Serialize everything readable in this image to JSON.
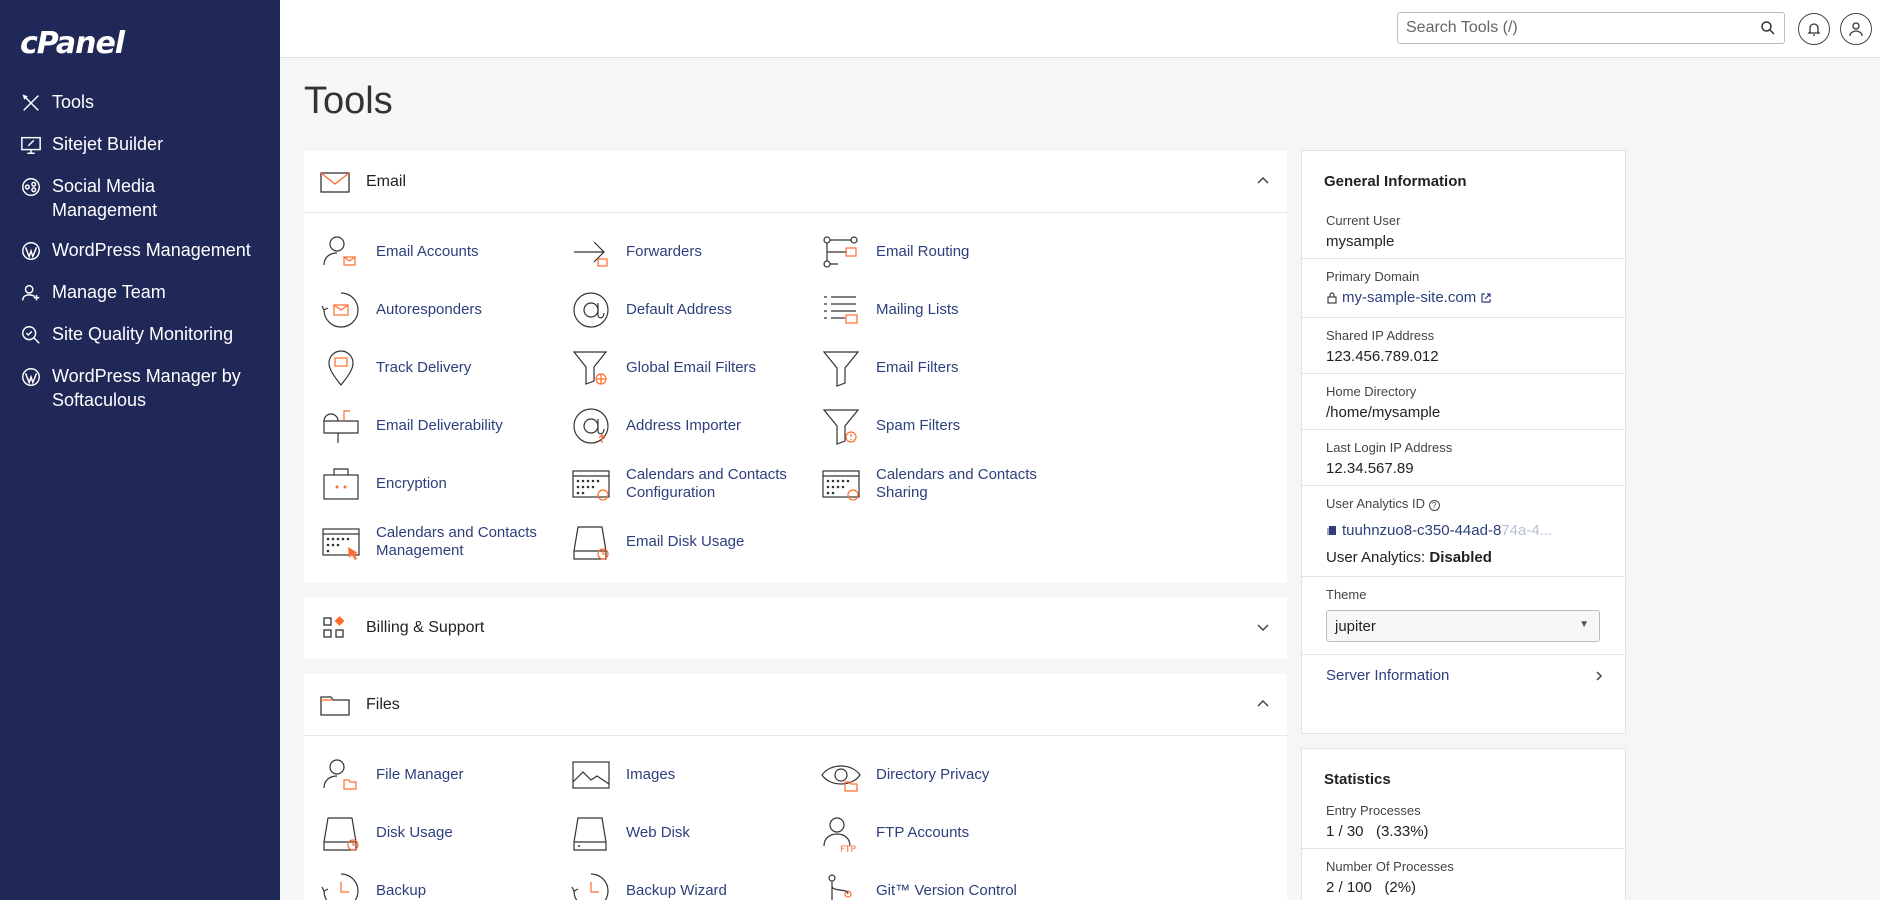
{
  "brand": "cPanel",
  "sidebar": {
    "items": [
      {
        "label": "Tools"
      },
      {
        "label": "Sitejet Builder"
      },
      {
        "label": "Social Media Management"
      },
      {
        "label": "WordPress Management"
      },
      {
        "label": "Manage Team"
      },
      {
        "label": "Site Quality Monitoring"
      },
      {
        "label": "WordPress Manager by Softaculous"
      }
    ]
  },
  "topbar": {
    "search_placeholder": "Search Tools (/)"
  },
  "page_title": "Tools",
  "email": {
    "title": "Email",
    "tools": [
      {
        "label": "Email Accounts",
        "icon": "user-mail-icon"
      },
      {
        "label": "Forwarders",
        "icon": "forward-arrow-icon"
      },
      {
        "label": "Email Routing",
        "icon": "routing-icon"
      },
      {
        "label": "Autoresponders",
        "icon": "autoresponder-icon"
      },
      {
        "label": "Default Address",
        "icon": "at-sign-icon"
      },
      {
        "label": "Mailing Lists",
        "icon": "list-mail-icon"
      },
      {
        "label": "Track Delivery",
        "icon": "map-pin-icon"
      },
      {
        "label": "Global Email Filters",
        "icon": "globe-filter-icon"
      },
      {
        "label": "Email Filters",
        "icon": "filter-icon"
      },
      {
        "label": "Email Deliverability",
        "icon": "mailbox-icon"
      },
      {
        "label": "Address Importer",
        "icon": "at-import-icon"
      },
      {
        "label": "Spam Filters",
        "icon": "spam-filter-icon"
      },
      {
        "label": "Encryption",
        "icon": "briefcase-icon"
      },
      {
        "label": "Calendars and Contacts Configuration",
        "icon": "calendar-at-icon"
      },
      {
        "label": "Calendars and Contacts Sharing",
        "icon": "calendar-share-icon"
      },
      {
        "label": "Calendars and Contacts Management",
        "icon": "calendar-cursor-icon"
      },
      {
        "label": "Email Disk Usage",
        "icon": "disk-clock-icon"
      }
    ]
  },
  "billing": {
    "title": "Billing & Support"
  },
  "files": {
    "title": "Files",
    "tools": [
      {
        "label": "File Manager",
        "icon": "user-folder-icon"
      },
      {
        "label": "Images",
        "icon": "image-icon"
      },
      {
        "label": "Directory Privacy",
        "icon": "eye-folder-icon"
      },
      {
        "label": "Disk Usage",
        "icon": "disk-clock-icon"
      },
      {
        "label": "Web Disk",
        "icon": "disk-icon"
      },
      {
        "label": "FTP Accounts",
        "icon": "user-ftp-icon"
      },
      {
        "label": "Backup",
        "icon": "backup-clock-icon"
      },
      {
        "label": "Backup Wizard",
        "icon": "backup-wizard-icon"
      },
      {
        "label": "Git™ Version Control",
        "icon": "git-icon"
      }
    ]
  },
  "general_info": {
    "title": "General Information",
    "current_user_key": "Current User",
    "current_user": "mysample",
    "primary_domain_key": "Primary Domain",
    "primary_domain": "my-sample-site.com",
    "shared_ip_key": "Shared IP Address",
    "shared_ip": "123.456.789.012",
    "home_dir_key": "Home Directory",
    "home_dir": "/home/mysample",
    "last_login_key": "Last Login IP Address",
    "last_login": "12.34.567.89",
    "analytics_id_key": "User Analytics ID",
    "analytics_id": "tuuhnzuo8-c350-44ad-8",
    "analytics_id_faded": "74a-4...",
    "analytics_status_key": "User Analytics:",
    "analytics_status": "Disabled",
    "theme_key": "Theme",
    "theme": "jupiter",
    "server_info": "Server Information"
  },
  "statistics": {
    "title": "Statistics",
    "entry_processes_key": "Entry Processes",
    "entry_processes": "1 / 30   (3.33%)",
    "num_processes_key": "Number Of Processes",
    "num_processes": "2 / 100   (2%)"
  },
  "colors": {
    "sidebar_bg": "#202857",
    "link": "#2d3f7c",
    "accent": "#ff6c2c"
  }
}
